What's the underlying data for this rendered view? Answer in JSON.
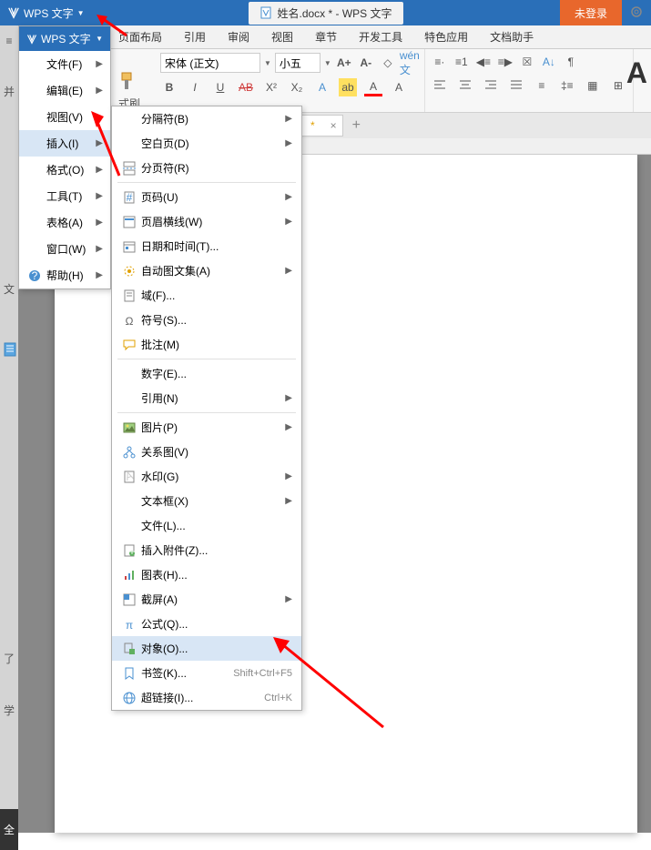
{
  "app": {
    "name": "WPS 文字"
  },
  "title": {
    "doc": "姓名.docx * - WPS 文字"
  },
  "login": "未登录",
  "ribbon_tabs": [
    "页面布局",
    "引用",
    "审阅",
    "视图",
    "章节",
    "开发工具",
    "特色应用",
    "文档助手"
  ],
  "format_brush": "式刷",
  "font": {
    "name": "宋体 (正文)",
    "size": "小五"
  },
  "doc_tab": {
    "label": "",
    "star": "*"
  },
  "menu1": {
    "header": "WPS 文字",
    "items": [
      {
        "label": "文件(F)",
        "arrow": true
      },
      {
        "label": "编辑(E)",
        "arrow": true
      },
      {
        "label": "视图(V)",
        "arrow": true
      },
      {
        "label": "插入(I)",
        "arrow": true,
        "highlight": true
      },
      {
        "label": "格式(O)",
        "arrow": true
      },
      {
        "label": "工具(T)",
        "arrow": true
      },
      {
        "label": "表格(A)",
        "arrow": true
      },
      {
        "label": "窗口(W)",
        "arrow": true
      },
      {
        "label": "帮助(H)",
        "arrow": true,
        "icon": "help"
      }
    ]
  },
  "menu2": {
    "items": [
      {
        "label": "分隔符(B)",
        "arrow": true
      },
      {
        "label": "空白页(D)",
        "arrow": true
      },
      {
        "label": "分页符(R)",
        "icon": "pagebreak"
      },
      {
        "sep": true
      },
      {
        "label": "页码(U)",
        "arrow": true,
        "icon": "pagenum"
      },
      {
        "label": "页眉横线(W)",
        "arrow": true,
        "icon": "headerline"
      },
      {
        "label": "日期和时间(T)...",
        "icon": "datetime"
      },
      {
        "label": "自动图文集(A)",
        "arrow": true,
        "icon": "autotext"
      },
      {
        "label": "域(F)...",
        "icon": "field"
      },
      {
        "label": "符号(S)...",
        "icon": "omega"
      },
      {
        "label": "批注(M)",
        "icon": "comment"
      },
      {
        "sep": true
      },
      {
        "label": "数字(E)..."
      },
      {
        "label": "引用(N)",
        "arrow": true
      },
      {
        "sep": true
      },
      {
        "label": "图片(P)",
        "arrow": true,
        "icon": "picture"
      },
      {
        "label": "关系图(V)",
        "icon": "diagram"
      },
      {
        "label": "水印(G)",
        "arrow": true,
        "icon": "watermark"
      },
      {
        "label": "文本框(X)",
        "arrow": true
      },
      {
        "label": "文件(L)..."
      },
      {
        "label": "插入附件(Z)...",
        "icon": "attach"
      },
      {
        "label": "图表(H)...",
        "icon": "chart"
      },
      {
        "label": "截屏(A)",
        "arrow": true,
        "icon": "screenshot"
      },
      {
        "label": "公式(Q)...",
        "icon": "pi"
      },
      {
        "label": "对象(O)...",
        "icon": "object",
        "highlight": true
      },
      {
        "label": "书签(K)...",
        "icon": "bookmark",
        "shortcut": "Shift+Ctrl+F5"
      },
      {
        "label": "超链接(I)...",
        "icon": "hyperlink",
        "shortcut": "Ctrl+K"
      }
    ]
  },
  "sidebar_page_icon": "page"
}
